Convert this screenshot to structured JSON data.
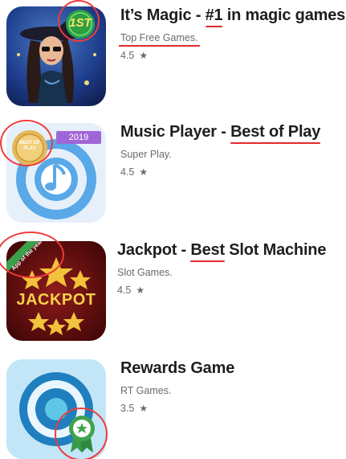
{
  "apps": [
    {
      "title_main": "It’s Magic - ",
      "title_highlight": "#1",
      "title_rest": " in magic games",
      "publisher": "Top Free Games.",
      "rating": "4.5",
      "badge_text": "1ST",
      "star_icon": "star-icon"
    },
    {
      "title_main": "Music Player - ",
      "title_highlight": "Best of Play",
      "title_rest": "",
      "publisher": "Super Play.",
      "rating": "4.5",
      "badge_text": "BEST OF PLAY",
      "year_tag": "2019",
      "star_icon": "star-icon"
    },
    {
      "title_main": "Jackpot - ",
      "title_highlight": "Best",
      "title_rest": " Slot Machine",
      "publisher": "Slot Games.",
      "rating": "4.5",
      "ribbon_text": "App of the year",
      "icon_word": "JACKPOT",
      "star_icon": "star-icon"
    },
    {
      "title_main": "Rewards Game",
      "title_highlight": "",
      "title_rest": "",
      "publisher": "RT Games.",
      "rating": "3.5",
      "star_icon": "star-icon"
    }
  ],
  "colors": {
    "annotation_red": "#ef3b3b",
    "text_primary": "#1e1e1e",
    "text_secondary": "#6b6b6b"
  }
}
